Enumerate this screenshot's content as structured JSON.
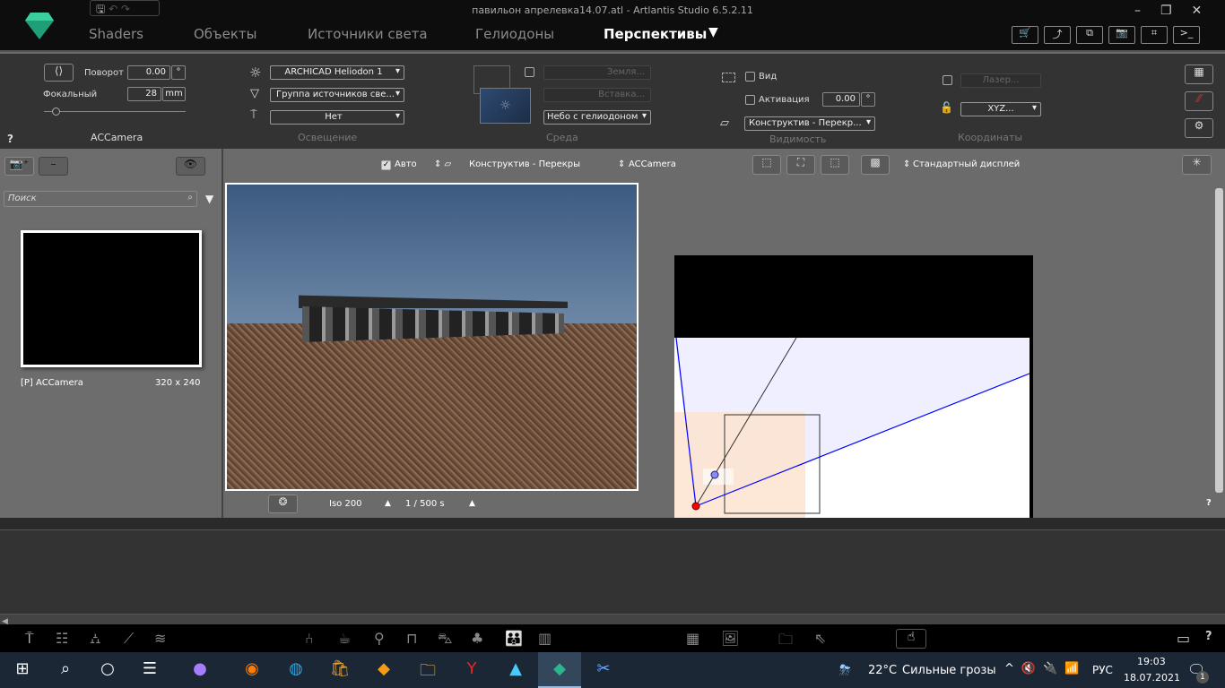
{
  "window": {
    "title": "павильон апрелевка14.07.atl - Artlantis Studio 6.5.2.11"
  },
  "tabs": [
    {
      "label": "Shaders"
    },
    {
      "label": "Объекты"
    },
    {
      "label": "Источники света"
    },
    {
      "label": "Гелиодоны"
    },
    {
      "label": "Перспективы",
      "active": true
    }
  ],
  "camera": {
    "rotation_label": "Поворот",
    "rotation_value": "0.00",
    "rotation_unit": "°",
    "focal_label": "Фокальный",
    "focal_value": "28",
    "focal_unit": "mm",
    "name": "ACCamera",
    "help": "?",
    "focal_slider": 0.05
  },
  "lighting": {
    "heliodon": "ARCHICAD Heliodon 1",
    "light_group": "Группа источников све...",
    "paint": "Нет",
    "section": "Освещение"
  },
  "environment": {
    "ground": "Земля...",
    "insert": "Вставка...",
    "sky": "Небо с гелиодоном",
    "section": "Среда"
  },
  "visibility": {
    "view_label": "Вид",
    "activation_label": "Активация",
    "activation_value": "0.00",
    "activation_unit": "°",
    "layer": "Конструктив - Перекр...",
    "section": "Видимость"
  },
  "coordinates": {
    "laser": "Лазер...",
    "xyz": "XYZ...",
    "section": "Координаты"
  },
  "left_panel": {
    "search_placeholder": "Поиск",
    "item_tag": "[P]",
    "item_name": "ACCamera",
    "item_size": "320 x 240"
  },
  "viewport_toolbar": {
    "auto_label": "Авто",
    "auto_checked": true,
    "layer": "Конструктив - Перекры",
    "camera": "ACCamera",
    "display": "Стандартный дисплей"
  },
  "exposure": {
    "iso": "Iso  200",
    "shutter": "1 /  500 s",
    "help": "?"
  },
  "taskbar": {
    "weather_temp": "22°C",
    "weather_text": "Сильные грозы",
    "lang": "РУС",
    "time": "19:03",
    "date": "18.07.2021",
    "notifications": "1"
  },
  "colors": {
    "accent": "#2bb58a",
    "plan_line": "#0000ff",
    "camera_point": "#ff0000"
  }
}
